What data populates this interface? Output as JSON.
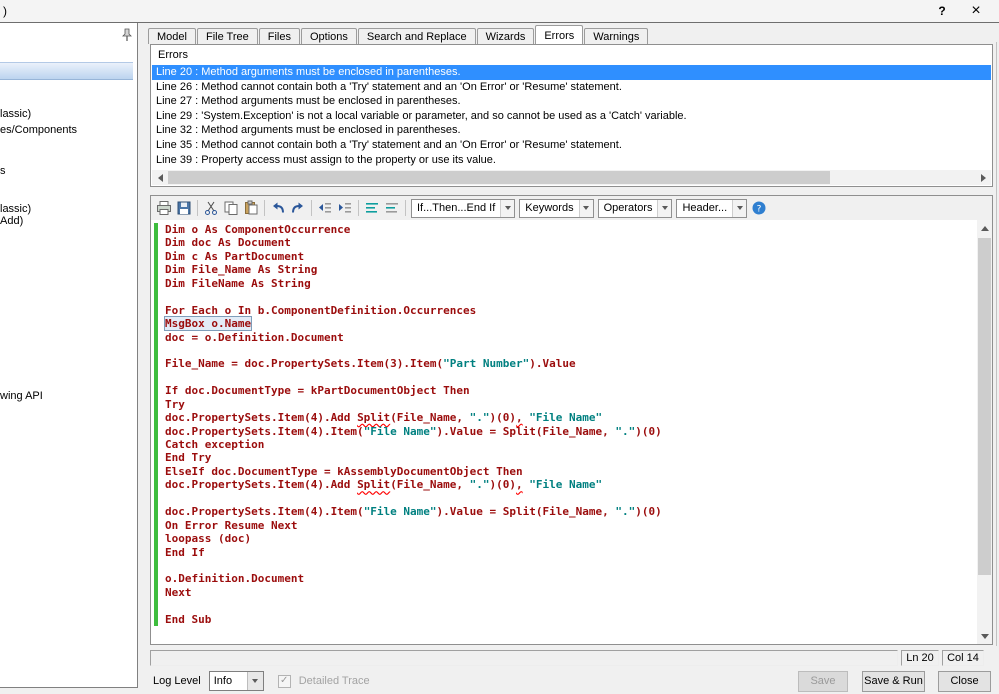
{
  "window": {
    "title_fragment": ")",
    "help_label": "?",
    "close_label": "×"
  },
  "left_panel": {
    "items": [
      "lassic)",
      "es/Components",
      "s",
      "lassic)",
      "Add)",
      "wing API"
    ]
  },
  "tabs": [
    {
      "label": "Model",
      "active": false
    },
    {
      "label": "File Tree",
      "active": false
    },
    {
      "label": "Files",
      "active": false
    },
    {
      "label": "Options",
      "active": false
    },
    {
      "label": "Search and Replace",
      "active": false
    },
    {
      "label": "Wizards",
      "active": false
    },
    {
      "label": "Errors",
      "active": true
    },
    {
      "label": "Warnings",
      "active": false
    }
  ],
  "errors_panel": {
    "title": "Errors",
    "errors": [
      {
        "text": "Line 20 : Method arguments must be enclosed in parentheses.",
        "selected": true
      },
      {
        "text": "Line 26 : Method cannot contain both a 'Try' statement and an 'On Error' or 'Resume' statement.",
        "selected": false
      },
      {
        "text": "Line 27 : Method arguments must be enclosed in parentheses.",
        "selected": false
      },
      {
        "text": "Line 29 : 'System.Exception' is not a local variable or parameter, and so cannot be used as a 'Catch' variable.",
        "selected": false
      },
      {
        "text": "Line 32 : Method arguments must be enclosed in parentheses.",
        "selected": false
      },
      {
        "text": "Line 35 : Method cannot contain both a 'Try' statement and an 'On Error' or 'Resume' statement.",
        "selected": false
      },
      {
        "text": "Line 39 : Property access must assign to the property or use its value.",
        "selected": false
      }
    ]
  },
  "editor": {
    "toolbar": {
      "icons": [
        "print-icon",
        "save-icon",
        "cut-icon",
        "copy-icon",
        "paste-icon",
        "undo-icon",
        "redo-icon",
        "outdent-icon",
        "indent-icon",
        "comment-icon",
        "uncomment-icon",
        "help-icon"
      ],
      "dropdowns": [
        "If...Then...End If",
        "Keywords",
        "Operators",
        "Header..."
      ]
    },
    "code_lines": [
      [
        {
          "t": "Dim o As ComponentOccurrence",
          "c": "c"
        }
      ],
      [
        {
          "t": "Dim doc As Document",
          "c": "c"
        }
      ],
      [
        {
          "t": "Dim c As PartDocument",
          "c": "c"
        }
      ],
      [
        {
          "t": "Dim File_Name As String",
          "c": "c"
        }
      ],
      [
        {
          "t": "Dim FileName As String",
          "c": "c"
        }
      ],
      [],
      [
        {
          "t": "For Each o In b.ComponentDefinition.Occurrences",
          "c": "c"
        }
      ],
      [
        {
          "t": "MsgBox o.Name",
          "c": "c box"
        }
      ],
      [
        {
          "t": "doc = o.Definition.Document",
          "c": "c"
        }
      ],
      [],
      [
        {
          "t": "File_Name = doc.PropertySets.Item(3).Item(",
          "c": "c"
        },
        {
          "t": "\"Part Number\"",
          "c": "s"
        },
        {
          "t": ").Value",
          "c": "c"
        }
      ],
      [],
      [
        {
          "t": "If doc.DocumentType = kPartDocumentObject Then",
          "c": "c"
        }
      ],
      [
        {
          "t": "Try",
          "c": "c"
        }
      ],
      [
        {
          "t": "doc.PropertySets.Item(4).Add ",
          "c": "c"
        },
        {
          "t": "Split",
          "c": "c e"
        },
        {
          "t": "(File_Name, ",
          "c": "c"
        },
        {
          "t": "\".\"",
          "c": "s"
        },
        {
          "t": ")(0)",
          "c": "c"
        },
        {
          "t": ",",
          "c": "c e"
        },
        {
          "t": " ",
          "c": "c"
        },
        {
          "t": "\"File Name\"",
          "c": "s"
        }
      ],
      [
        {
          "t": "doc.PropertySets.Item(4).Item(",
          "c": "c"
        },
        {
          "t": "\"File Name\"",
          "c": "s"
        },
        {
          "t": ").Value = Split(File_Name, ",
          "c": "c"
        },
        {
          "t": "\".\"",
          "c": "s"
        },
        {
          "t": ")(0)",
          "c": "c"
        }
      ],
      [
        {
          "t": "Catch exception",
          "c": "c"
        }
      ],
      [
        {
          "t": "End Try",
          "c": "c"
        }
      ],
      [
        {
          "t": "ElseIf doc.DocumentType = kAssemblyDocumentObject Then",
          "c": "c"
        }
      ],
      [
        {
          "t": "doc.PropertySets.Item(4).Add ",
          "c": "c"
        },
        {
          "t": "Split",
          "c": "c e"
        },
        {
          "t": "(File_Name, ",
          "c": "c"
        },
        {
          "t": "\".\"",
          "c": "s"
        },
        {
          "t": ")(0)",
          "c": "c"
        },
        {
          "t": ",",
          "c": "c e"
        },
        {
          "t": " ",
          "c": "c"
        },
        {
          "t": "\"File Name\"",
          "c": "s"
        }
      ],
      [],
      [
        {
          "t": "doc.PropertySets.Item(4).Item(",
          "c": "c"
        },
        {
          "t": "\"File Name\"",
          "c": "s"
        },
        {
          "t": ").Value = Split(File_Name, ",
          "c": "c"
        },
        {
          "t": "\".\"",
          "c": "s"
        },
        {
          "t": ")(0)",
          "c": "c"
        }
      ],
      [
        {
          "t": "On Error Resume Next",
          "c": "c"
        }
      ],
      [
        {
          "t": "loopass (doc)",
          "c": "c"
        }
      ],
      [
        {
          "t": "End If",
          "c": "c"
        }
      ],
      [],
      [
        {
          "t": "o.Definition.Document",
          "c": "c"
        }
      ],
      [
        {
          "t": "Next",
          "c": "c"
        }
      ],
      [],
      [
        {
          "t": "End Sub",
          "c": "c"
        }
      ]
    ]
  },
  "status_bar": {
    "line": "Ln 20",
    "col": "Col 14"
  },
  "bottom_bar": {
    "log_level_label": "Log Level",
    "log_level_value": "Info",
    "detailed_trace_label": "Detailed Trace",
    "detailed_trace_checked": true,
    "save_label": "Save",
    "save_run_label": "Save & Run",
    "close_label": "Close"
  },
  "colors": {
    "selection_blue": "#2f8fff",
    "code_maroon": "#9b0c0c",
    "string_teal": "#008080",
    "change_bar_green": "#3ebd3e",
    "error_squiggle_red": "#ff0000"
  }
}
